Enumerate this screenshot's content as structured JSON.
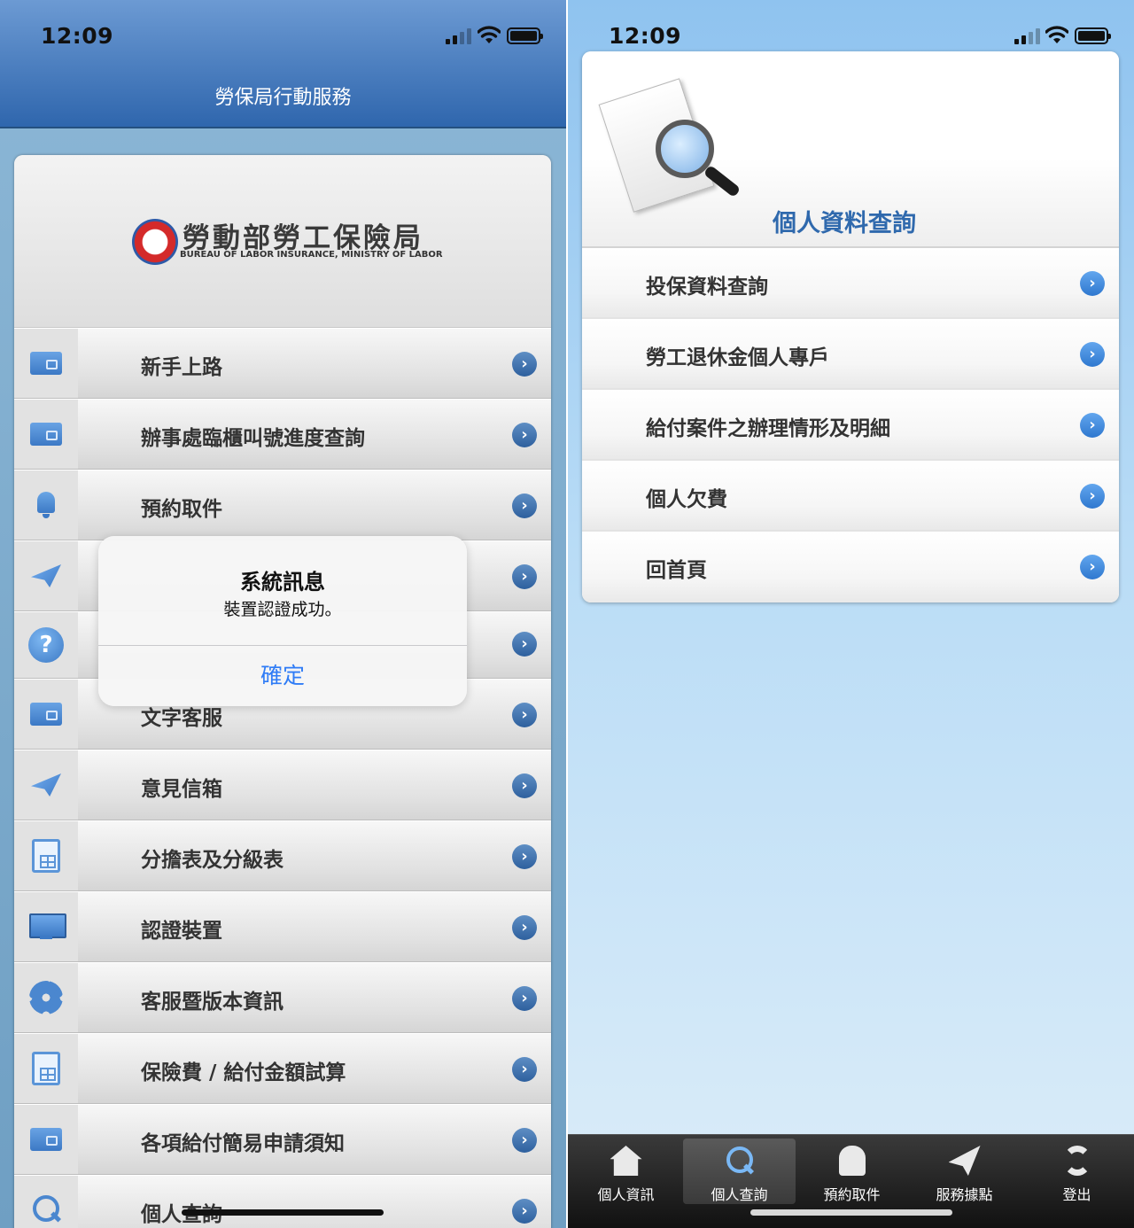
{
  "left": {
    "status_time": "12:09",
    "nav_title": "勞保局行動服務",
    "logo": {
      "name_cn": "勞動部勞工保險局",
      "name_en": "BUREAU OF LABOR INSURANCE, MINISTRY OF LABOR"
    },
    "menu": [
      {
        "label": "新手上路",
        "icon": "wallet-icon"
      },
      {
        "label": "辦事處臨櫃叫號進度查詢",
        "icon": "wallet-icon"
      },
      {
        "label": "預約取件",
        "icon": "bell-icon"
      },
      {
        "label": "",
        "icon": "paper-plane-icon"
      },
      {
        "label": "",
        "icon": "help-icon"
      },
      {
        "label": "文字客服",
        "icon": "wallet-icon"
      },
      {
        "label": "意見信箱",
        "icon": "paper-plane-icon"
      },
      {
        "label": "分擔表及分級表",
        "icon": "spreadsheet-icon"
      },
      {
        "label": "認證裝置",
        "icon": "monitor-icon"
      },
      {
        "label": "客服暨版本資訊",
        "icon": "gear-icon"
      },
      {
        "label": "保險費 / 給付金額試算",
        "icon": "spreadsheet-icon"
      },
      {
        "label": "各項給付簡易申請須知",
        "icon": "wallet-icon"
      },
      {
        "label": "個人查詢",
        "icon": "magnifier-icon"
      }
    ],
    "alert": {
      "title": "系統訊息",
      "message": "裝置認證成功。",
      "button": "確定"
    }
  },
  "right": {
    "status_time": "12:09",
    "header_title": "個人資料查詢",
    "menu": [
      {
        "label": "投保資料查詢"
      },
      {
        "label": "勞工退休金個人專戶"
      },
      {
        "label": "給付案件之辦理情形及明細"
      },
      {
        "label": "個人欠費"
      },
      {
        "label": "回首頁"
      }
    ],
    "tabs": [
      {
        "label": "個人資訊",
        "icon": "house-icon",
        "active": false
      },
      {
        "label": "個人查詢",
        "icon": "search-icon",
        "active": true
      },
      {
        "label": "預約取件",
        "icon": "bell-icon",
        "active": false
      },
      {
        "label": "服務據點",
        "icon": "paper-plane-icon",
        "active": false
      },
      {
        "label": "登出",
        "icon": "refresh-icon",
        "active": false
      }
    ]
  },
  "colors": {
    "nav_blue": "#2f66ad",
    "chevron_blue": "#2e609e",
    "alert_button": "#2f7cf6",
    "header_title": "#2f69ad"
  }
}
